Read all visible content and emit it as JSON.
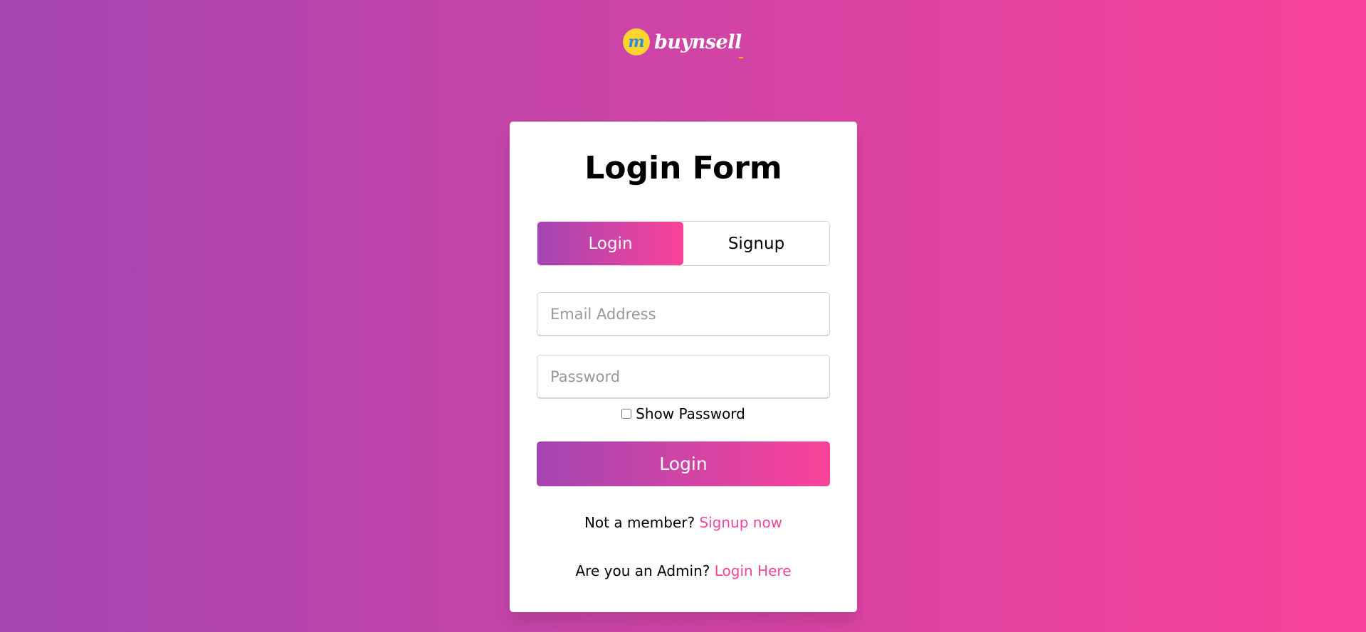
{
  "brand": {
    "badge_letter": "m",
    "name": "buynsell"
  },
  "form": {
    "title": "Login Form",
    "tabs": [
      {
        "label": "Login",
        "active": true
      },
      {
        "label": "Signup",
        "active": false
      }
    ],
    "email": {
      "placeholder": "Email Address",
      "value": ""
    },
    "password": {
      "placeholder": "Password",
      "value": ""
    },
    "show_password": {
      "label": "Show Password",
      "checked": false
    },
    "submit_label": "Login",
    "member_prompt": "Not a member?",
    "member_link": "Signup now",
    "admin_prompt": "Are you an Admin?",
    "admin_link": "Login Here"
  },
  "colors": {
    "gradient_start": "#a445b2",
    "gradient_end": "#fa4299",
    "link": "#fa4299",
    "logo_badge": "#fdd32f"
  }
}
